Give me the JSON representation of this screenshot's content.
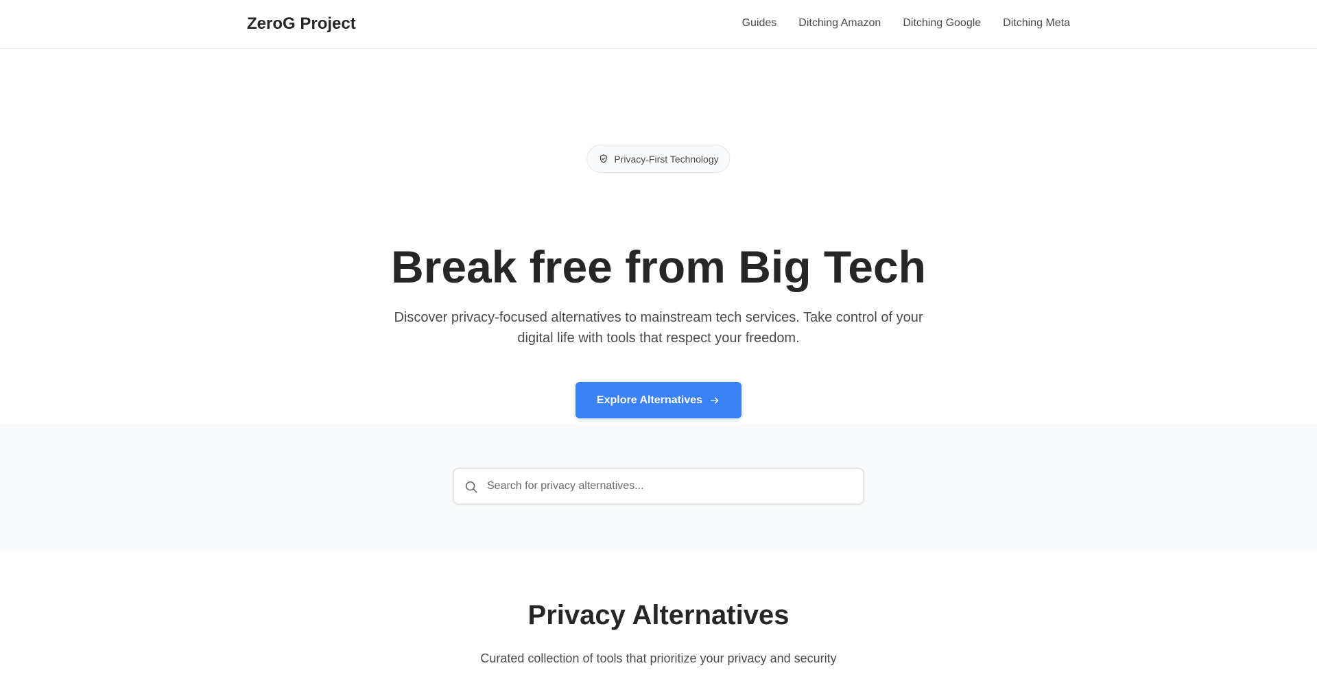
{
  "header": {
    "brand": "ZeroG Project",
    "nav": [
      {
        "label": "Guides"
      },
      {
        "label": "Ditching Amazon"
      },
      {
        "label": "Ditching Google"
      },
      {
        "label": "Ditching Meta"
      }
    ]
  },
  "hero": {
    "badge_icon": "shield-check-icon",
    "badge_text": "Privacy-First Technology",
    "title": "Break free from Big Tech",
    "subtitle": "Discover privacy-focused alternatives to mainstream tech services. Take control of your digital life with tools that respect your freedom.",
    "cta_label": "Explore Alternatives",
    "cta_icon": "arrow-right-icon"
  },
  "search": {
    "icon": "search-icon",
    "placeholder": "Search for privacy alternatives...",
    "value": ""
  },
  "section": {
    "title": "Privacy Alternatives",
    "subtitle": "Curated collection of tools that prioritize your privacy and security"
  },
  "colors": {
    "accent": "#3b82f6",
    "text": "#262626",
    "muted": "#4a4a4a",
    "band": "#f9fafb"
  }
}
